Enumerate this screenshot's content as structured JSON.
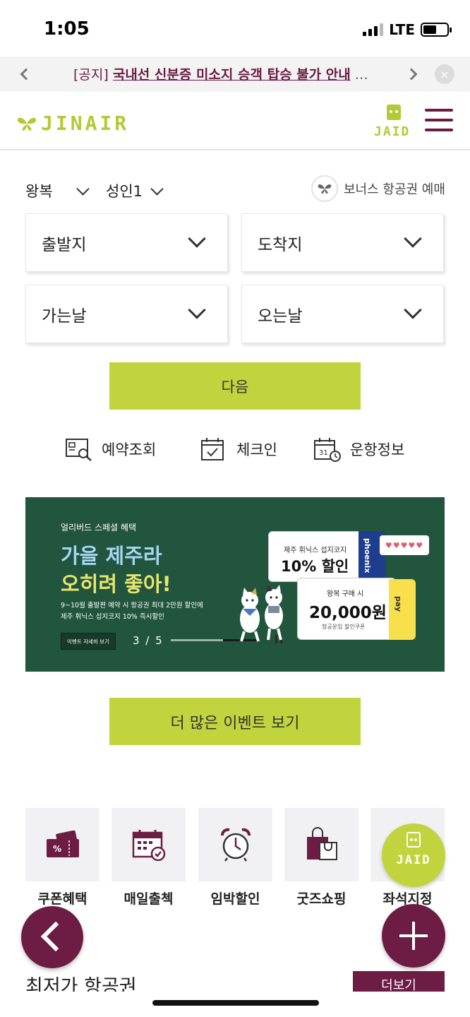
{
  "status": {
    "time": "1:05",
    "network": "LTE",
    "battery_level": 0.55
  },
  "notice": {
    "tag": "[공지]",
    "text": "국내선 신분증 미소지 승객 탑승 불가 안내",
    "ellipsis": "…",
    "close": "×"
  },
  "header": {
    "logo": "JINAIR",
    "jaid": "JAID"
  },
  "booking": {
    "trip_type": "왕복",
    "passengers": "성인1",
    "bonus": "보너스 항공권 예매",
    "departure": "출발지",
    "arrival": "도착지",
    "depart_date": "가는날",
    "return_date": "오는날",
    "next": "다음"
  },
  "quick_links": [
    {
      "label": "예약조회",
      "icon": "reservation-search-icon"
    },
    {
      "label": "체크인",
      "icon": "checkin-calendar-icon"
    },
    {
      "label": "운항정보",
      "icon": "flight-schedule-icon"
    }
  ],
  "banner": {
    "subtitle": "얼리버드 스페셜 혜택",
    "title_line1": "가을 제주라",
    "title_line2": "오히려 좋아!",
    "desc_line1": "9~10월 출발편 예약 시 항공권 최대 2만원 할인에",
    "desc_line2": "제주 휘닉스 섭지코지 10% 즉시할인",
    "detail_button": "이벤트 자세히 보기",
    "page": "3 / 5",
    "progress": 0.6,
    "card1_sub": "제주 휘닉스 섭지코지",
    "card1_main": "10% 할인",
    "card1_stub": "phoenix",
    "card2_sub": "왕복 구매 시",
    "card2_main": "20,000원",
    "card2_note": "항공운임 할인쿠폰",
    "card2_stub": "pay",
    "bubble": "♥♥♥♥♥"
  },
  "events_button": "더 많은 이벤트 보기",
  "categories": [
    {
      "label": "쿠폰혜택",
      "icon": "coupon-icon"
    },
    {
      "label": "매일출첵",
      "icon": "daily-checkin-calendar-icon"
    },
    {
      "label": "임박할인",
      "icon": "alarm-clock-icon"
    },
    {
      "label": "굿즈쇼핑",
      "icon": "shopping-bag-icon"
    },
    {
      "label": "좌석지정",
      "icon": "seat-icon"
    }
  ],
  "floating": {
    "jaid": "JAID"
  },
  "lowest": {
    "title": "최저가 항공권",
    "more": "더보기"
  },
  "colors": {
    "brand_green": "#c2d43d",
    "brand_purple": "#6d1c44",
    "banner_bg": "#22553d"
  }
}
